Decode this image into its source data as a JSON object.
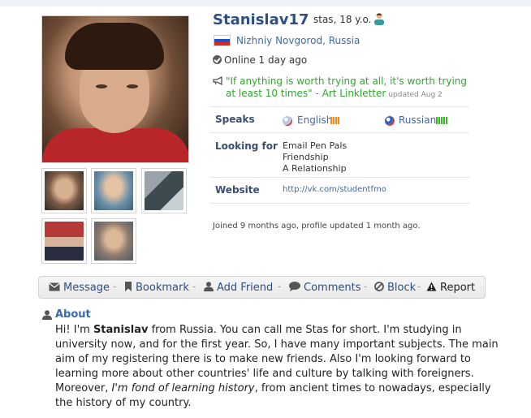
{
  "profile": {
    "username": "Stanislav17",
    "age_text": "stas, 18 y.o.",
    "city": "Nizhniy Novgorod",
    "location_separator": ", ",
    "country": "Russia",
    "online_status": "Online 1 day ago",
    "quote": "\"If anything is worth trying at all, it's worth trying at least 10 times\" - Art Linkletter",
    "quote_updated": "updated Aug 2"
  },
  "details": {
    "speaks_label": "Speaks",
    "languages": [
      {
        "name": "English",
        "level_color": "#f08a1c",
        "globe_color": "#b8c9e6"
      },
      {
        "name": "Russian",
        "level_color": "#3db32c",
        "globe_color": "#d24a45"
      }
    ],
    "looking_for_label": "Looking for",
    "looking_for": [
      "Email Pen Pals",
      "Friendship",
      "A Relationship"
    ],
    "website_label": "Website",
    "website": "http://vk.com/studentfmo",
    "joined": "Joined 9 months ago, profile updated 1 month ago."
  },
  "actions": {
    "message": "Message",
    "bookmark": "Bookmark",
    "add_friend": "Add Friend",
    "comments": "Comments",
    "block": "Block",
    "report": "Report"
  },
  "about": {
    "title": "About",
    "text_1": "Hi! I'm ",
    "name_bold": "Stanislav",
    "text_2": " from Russia. You can call me Stas for short. I'm studying in university now, and for the first year. So, I have many important subjects. The main aim of my registering there is to make new friends. Also I'm looking forward to learning more about other countries' life and culture by talking with foreigners. Moreover, ",
    "text_italic": "I'm fond of learning history",
    "text_3": ", from ancient times to nowadays, especially the history of my country."
  },
  "colors": {
    "accent_blue": "#2d4f85",
    "link_blue": "#3c6aa8",
    "quote_green": "#2fa82b"
  }
}
